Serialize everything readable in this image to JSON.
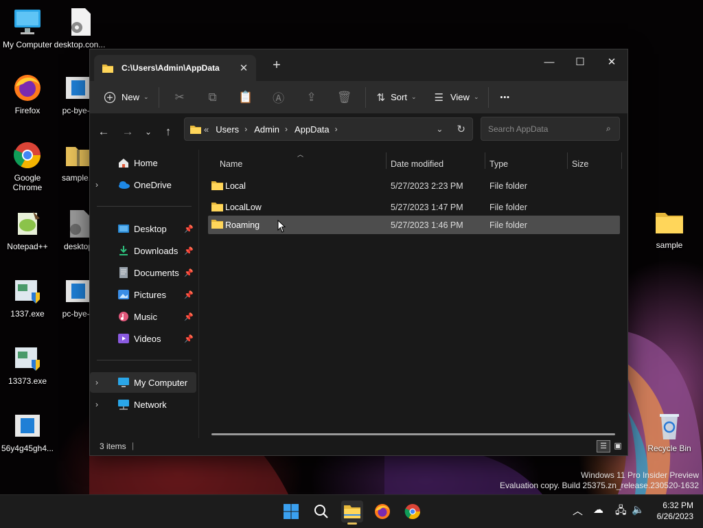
{
  "desktop": {
    "icons": [
      {
        "label": "My Computer",
        "icon": "monitor-icon"
      },
      {
        "label": "desktop.con...",
        "icon": "config-file-icon"
      },
      {
        "label": "Firefox",
        "icon": "firefox-icon"
      },
      {
        "label": "pc-bye-b",
        "icon": "app-window-icon"
      },
      {
        "label": "Google Chrome",
        "icon": "chrome-icon"
      },
      {
        "label": "sample.c",
        "icon": "zip-folder-icon"
      },
      {
        "label": "Notepad++",
        "icon": "notepadpp-icon"
      },
      {
        "label": "desktop",
        "icon": "config-file-icon"
      },
      {
        "label": "1337.exe",
        "icon": "installer-icon"
      },
      {
        "label": "pc-bye-b",
        "icon": "app-window-icon"
      },
      {
        "label": "13373.exe",
        "icon": "installer-icon"
      },
      {
        "label": "56y4g45gh4...",
        "icon": "app-window-icon"
      },
      {
        "label": "sample",
        "icon": "folder-icon"
      },
      {
        "label": "Recycle Bin",
        "icon": "recycle-bin-icon"
      }
    ],
    "watermark": {
      "line1": "Windows 11 Pro Insider Preview",
      "line2": "Evaluation copy. Build 25375.zn_release.230520-1632"
    }
  },
  "explorer": {
    "tab_title": "C:\\Users\\Admin\\AppData",
    "window_controls": {
      "minimize": "—",
      "maximize": "☐",
      "close": "✕"
    },
    "toolbar": {
      "new_label": "New",
      "sort_label": "Sort",
      "view_label": "View",
      "more_label": "•••"
    },
    "address": {
      "overflow": "«",
      "crumbs": [
        "Users",
        "Admin",
        "AppData"
      ]
    },
    "search": {
      "placeholder": "Search AppData"
    },
    "nav": {
      "home": "Home",
      "onedrive": "OneDrive",
      "pinned": [
        "Desktop",
        "Downloads",
        "Documents",
        "Pictures",
        "Music",
        "Videos"
      ],
      "my_computer": "My Computer",
      "network": "Network"
    },
    "columns": [
      "Name",
      "Date modified",
      "Type",
      "Size"
    ],
    "rows": [
      {
        "name": "Local",
        "date": "5/27/2023 2:23 PM",
        "type": "File folder"
      },
      {
        "name": "LocalLow",
        "date": "5/27/2023 1:47 PM",
        "type": "File folder"
      },
      {
        "name": "Roaming",
        "date": "5/27/2023 1:46 PM",
        "type": "File folder"
      }
    ],
    "status": "3 items",
    "accent": "#f4c542"
  },
  "taskbar": {
    "clock_time": "6:32 PM",
    "clock_date": "6/26/2023"
  }
}
